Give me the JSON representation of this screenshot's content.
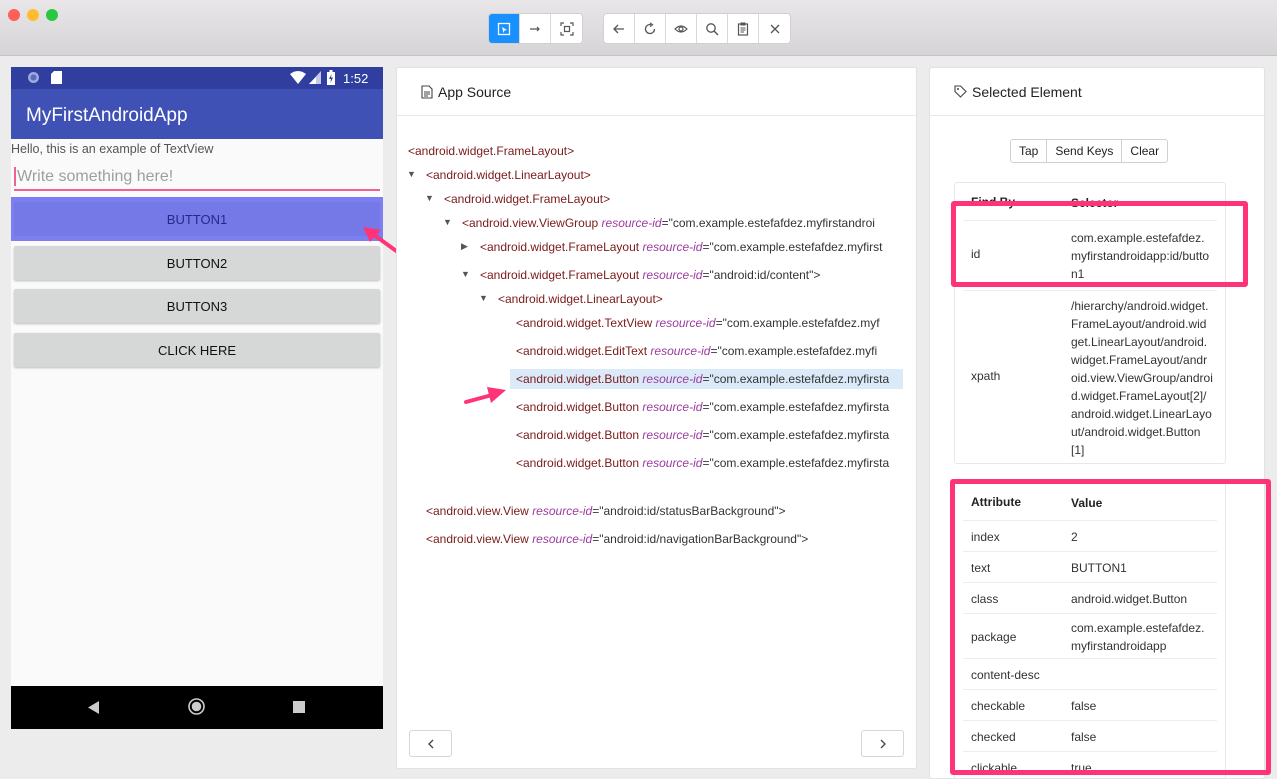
{
  "window": {
    "traffic_lights": [
      "#fe5f57",
      "#febc2e",
      "#28c840"
    ],
    "toolbar_icons": [
      "select-icon",
      "swipe-icon",
      "tap-coordinates-icon",
      "back-icon",
      "refresh-icon",
      "eye-icon",
      "search-icon",
      "clipboard-icon",
      "close-icon"
    ]
  },
  "phone": {
    "time": "1:52",
    "app_title": "MyFirstAndroidApp",
    "textview": "Hello, this is an example of TextView",
    "edittext_placeholder": "Write something here!",
    "buttons": [
      "BUTTON1",
      "BUTTON2",
      "BUTTON3",
      "CLICK HERE"
    ],
    "colors": {
      "statusbar": "#303f9f",
      "appbar": "#3f51b5",
      "highlight": "#7b7ff0"
    }
  },
  "source": {
    "title": "App Source",
    "rows": [
      {
        "tag": "<android.widget.FrameLayout>",
        "attr": "",
        "val": ""
      },
      {
        "tag": "<android.widget.LinearLayout>",
        "attr": "",
        "val": ""
      },
      {
        "tag": "<android.widget.FrameLayout>",
        "attr": "",
        "val": ""
      },
      {
        "tag": "<android.view.ViewGroup ",
        "attr": "resource-id",
        "val": "=\"com.example.estefafdez.myfirstandroi"
      },
      {
        "tag": "<android.widget.FrameLayout ",
        "attr": "resource-id",
        "val": "=\"com.example.estefafdez.myfirst"
      },
      {
        "tag": "<android.widget.FrameLayout ",
        "attr": "resource-id",
        "val": "=\"android:id/content\">"
      },
      {
        "tag": "<android.widget.LinearLayout>",
        "attr": "",
        "val": ""
      },
      {
        "tag": "<android.widget.TextView ",
        "attr": "resource-id",
        "val": "=\"com.example.estefafdez.myf"
      },
      {
        "tag": "<android.widget.EditText ",
        "attr": "resource-id",
        "val": "=\"com.example.estefafdez.myfi"
      },
      {
        "tag": "<android.widget.Button ",
        "attr": "resource-id",
        "val": "=\"com.example.estefafdez.myfirsta"
      },
      {
        "tag": "<android.widget.Button ",
        "attr": "resource-id",
        "val": "=\"com.example.estefafdez.myfirsta"
      },
      {
        "tag": "<android.widget.Button ",
        "attr": "resource-id",
        "val": "=\"com.example.estefafdez.myfirsta"
      },
      {
        "tag": "<android.widget.Button ",
        "attr": "resource-id",
        "val": "=\"com.example.estefafdez.myfirsta"
      },
      {
        "tag": "<android.view.View ",
        "attr": "resource-id",
        "val": "=\"android:id/statusBarBackground\">"
      },
      {
        "tag": "<android.view.View ",
        "attr": "resource-id",
        "val": "=\"android:id/navigationBarBackground\">"
      }
    ],
    "selected_index": 9
  },
  "selected": {
    "title": "Selected Element",
    "actions": [
      "Tap",
      "Send Keys",
      "Clear"
    ],
    "find_by_header": [
      "Find By",
      "Selector"
    ],
    "find_by": [
      {
        "k": "id",
        "v": "com.example.estefafdez.myfirstandroidapp:id/button1"
      },
      {
        "k": "xpath",
        "v": "/hierarchy/android.widget.FrameLayout/android.widget.LinearLayout/android.widget.FrameLayout/android.view.ViewGroup/android.widget.FrameLayout[2]/android.widget.LinearLayout/android.widget.Button[1]"
      }
    ],
    "attr_header": [
      "Attribute",
      "Value"
    ],
    "attributes": [
      {
        "k": "index",
        "v": "2"
      },
      {
        "k": "text",
        "v": "BUTTON1"
      },
      {
        "k": "class",
        "v": "android.widget.Button"
      },
      {
        "k": "package",
        "v": "com.example.estefafdez.myfirstandroidapp"
      },
      {
        "k": "content-desc",
        "v": ""
      },
      {
        "k": "checkable",
        "v": "false"
      },
      {
        "k": "checked",
        "v": "false"
      },
      {
        "k": "clickable",
        "v": "true"
      }
    ]
  }
}
